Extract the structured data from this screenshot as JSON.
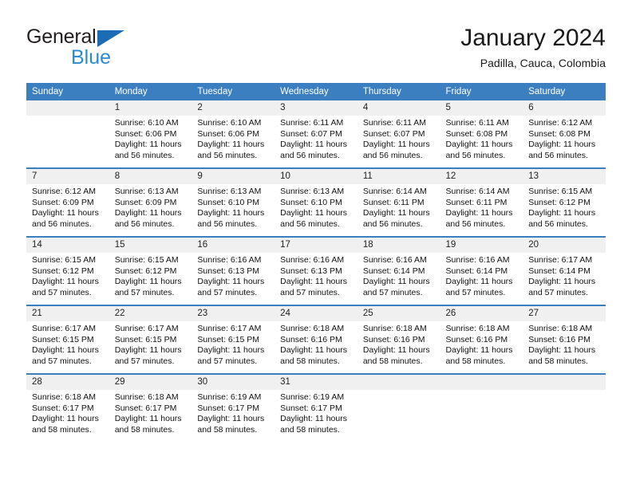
{
  "brand": {
    "name_part1": "General",
    "name_part2": "Blue",
    "triangle_color": "#1b6bb5",
    "text_color_part2": "#2b8ad6"
  },
  "header": {
    "title": "January 2024",
    "location": "Padilla, Cauca, Colombia"
  },
  "theme": {
    "header_bg": "#3c7fc1",
    "header_text": "#ffffff",
    "daynum_bg": "#f0f0f0",
    "cell_bg": "#ffffff",
    "row_divider": "#3c7fc1"
  },
  "weekday_headers": [
    "Sunday",
    "Monday",
    "Tuesday",
    "Wednesday",
    "Thursday",
    "Friday",
    "Saturday"
  ],
  "labels": {
    "sunrise_prefix": "Sunrise:",
    "sunset_prefix": "Sunset:",
    "daylight_prefix": "Daylight:"
  },
  "weeks": [
    {
      "days": [
        {
          "num": "",
          "blank": true,
          "line1": "",
          "line2": "",
          "line3": "",
          "line4": ""
        },
        {
          "num": "1",
          "blank": false,
          "line1": "Sunrise: 6:10 AM",
          "line2": "Sunset: 6:06 PM",
          "line3": "Daylight: 11 hours",
          "line4": "and 56 minutes."
        },
        {
          "num": "2",
          "blank": false,
          "line1": "Sunrise: 6:10 AM",
          "line2": "Sunset: 6:06 PM",
          "line3": "Daylight: 11 hours",
          "line4": "and 56 minutes."
        },
        {
          "num": "3",
          "blank": false,
          "line1": "Sunrise: 6:11 AM",
          "line2": "Sunset: 6:07 PM",
          "line3": "Daylight: 11 hours",
          "line4": "and 56 minutes."
        },
        {
          "num": "4",
          "blank": false,
          "line1": "Sunrise: 6:11 AM",
          "line2": "Sunset: 6:07 PM",
          "line3": "Daylight: 11 hours",
          "line4": "and 56 minutes."
        },
        {
          "num": "5",
          "blank": false,
          "line1": "Sunrise: 6:11 AM",
          "line2": "Sunset: 6:08 PM",
          "line3": "Daylight: 11 hours",
          "line4": "and 56 minutes."
        },
        {
          "num": "6",
          "blank": false,
          "line1": "Sunrise: 6:12 AM",
          "line2": "Sunset: 6:08 PM",
          "line3": "Daylight: 11 hours",
          "line4": "and 56 minutes."
        }
      ]
    },
    {
      "days": [
        {
          "num": "7",
          "blank": false,
          "line1": "Sunrise: 6:12 AM",
          "line2": "Sunset: 6:09 PM",
          "line3": "Daylight: 11 hours",
          "line4": "and 56 minutes."
        },
        {
          "num": "8",
          "blank": false,
          "line1": "Sunrise: 6:13 AM",
          "line2": "Sunset: 6:09 PM",
          "line3": "Daylight: 11 hours",
          "line4": "and 56 minutes."
        },
        {
          "num": "9",
          "blank": false,
          "line1": "Sunrise: 6:13 AM",
          "line2": "Sunset: 6:10 PM",
          "line3": "Daylight: 11 hours",
          "line4": "and 56 minutes."
        },
        {
          "num": "10",
          "blank": false,
          "line1": "Sunrise: 6:13 AM",
          "line2": "Sunset: 6:10 PM",
          "line3": "Daylight: 11 hours",
          "line4": "and 56 minutes."
        },
        {
          "num": "11",
          "blank": false,
          "line1": "Sunrise: 6:14 AM",
          "line2": "Sunset: 6:11 PM",
          "line3": "Daylight: 11 hours",
          "line4": "and 56 minutes."
        },
        {
          "num": "12",
          "blank": false,
          "line1": "Sunrise: 6:14 AM",
          "line2": "Sunset: 6:11 PM",
          "line3": "Daylight: 11 hours",
          "line4": "and 56 minutes."
        },
        {
          "num": "13",
          "blank": false,
          "line1": "Sunrise: 6:15 AM",
          "line2": "Sunset: 6:12 PM",
          "line3": "Daylight: 11 hours",
          "line4": "and 56 minutes."
        }
      ]
    },
    {
      "days": [
        {
          "num": "14",
          "blank": false,
          "line1": "Sunrise: 6:15 AM",
          "line2": "Sunset: 6:12 PM",
          "line3": "Daylight: 11 hours",
          "line4": "and 57 minutes."
        },
        {
          "num": "15",
          "blank": false,
          "line1": "Sunrise: 6:15 AM",
          "line2": "Sunset: 6:12 PM",
          "line3": "Daylight: 11 hours",
          "line4": "and 57 minutes."
        },
        {
          "num": "16",
          "blank": false,
          "line1": "Sunrise: 6:16 AM",
          "line2": "Sunset: 6:13 PM",
          "line3": "Daylight: 11 hours",
          "line4": "and 57 minutes."
        },
        {
          "num": "17",
          "blank": false,
          "line1": "Sunrise: 6:16 AM",
          "line2": "Sunset: 6:13 PM",
          "line3": "Daylight: 11 hours",
          "line4": "and 57 minutes."
        },
        {
          "num": "18",
          "blank": false,
          "line1": "Sunrise: 6:16 AM",
          "line2": "Sunset: 6:14 PM",
          "line3": "Daylight: 11 hours",
          "line4": "and 57 minutes."
        },
        {
          "num": "19",
          "blank": false,
          "line1": "Sunrise: 6:16 AM",
          "line2": "Sunset: 6:14 PM",
          "line3": "Daylight: 11 hours",
          "line4": "and 57 minutes."
        },
        {
          "num": "20",
          "blank": false,
          "line1": "Sunrise: 6:17 AM",
          "line2": "Sunset: 6:14 PM",
          "line3": "Daylight: 11 hours",
          "line4": "and 57 minutes."
        }
      ]
    },
    {
      "days": [
        {
          "num": "21",
          "blank": false,
          "line1": "Sunrise: 6:17 AM",
          "line2": "Sunset: 6:15 PM",
          "line3": "Daylight: 11 hours",
          "line4": "and 57 minutes."
        },
        {
          "num": "22",
          "blank": false,
          "line1": "Sunrise: 6:17 AM",
          "line2": "Sunset: 6:15 PM",
          "line3": "Daylight: 11 hours",
          "line4": "and 57 minutes."
        },
        {
          "num": "23",
          "blank": false,
          "line1": "Sunrise: 6:17 AM",
          "line2": "Sunset: 6:15 PM",
          "line3": "Daylight: 11 hours",
          "line4": "and 57 minutes."
        },
        {
          "num": "24",
          "blank": false,
          "line1": "Sunrise: 6:18 AM",
          "line2": "Sunset: 6:16 PM",
          "line3": "Daylight: 11 hours",
          "line4": "and 58 minutes."
        },
        {
          "num": "25",
          "blank": false,
          "line1": "Sunrise: 6:18 AM",
          "line2": "Sunset: 6:16 PM",
          "line3": "Daylight: 11 hours",
          "line4": "and 58 minutes."
        },
        {
          "num": "26",
          "blank": false,
          "line1": "Sunrise: 6:18 AM",
          "line2": "Sunset: 6:16 PM",
          "line3": "Daylight: 11 hours",
          "line4": "and 58 minutes."
        },
        {
          "num": "27",
          "blank": false,
          "line1": "Sunrise: 6:18 AM",
          "line2": "Sunset: 6:16 PM",
          "line3": "Daylight: 11 hours",
          "line4": "and 58 minutes."
        }
      ]
    },
    {
      "days": [
        {
          "num": "28",
          "blank": false,
          "line1": "Sunrise: 6:18 AM",
          "line2": "Sunset: 6:17 PM",
          "line3": "Daylight: 11 hours",
          "line4": "and 58 minutes."
        },
        {
          "num": "29",
          "blank": false,
          "line1": "Sunrise: 6:18 AM",
          "line2": "Sunset: 6:17 PM",
          "line3": "Daylight: 11 hours",
          "line4": "and 58 minutes."
        },
        {
          "num": "30",
          "blank": false,
          "line1": "Sunrise: 6:19 AM",
          "line2": "Sunset: 6:17 PM",
          "line3": "Daylight: 11 hours",
          "line4": "and 58 minutes."
        },
        {
          "num": "31",
          "blank": false,
          "line1": "Sunrise: 6:19 AM",
          "line2": "Sunset: 6:17 PM",
          "line3": "Daylight: 11 hours",
          "line4": "and 58 minutes."
        },
        {
          "num": "",
          "blank": true,
          "line1": "",
          "line2": "",
          "line3": "",
          "line4": ""
        },
        {
          "num": "",
          "blank": true,
          "line1": "",
          "line2": "",
          "line3": "",
          "line4": ""
        },
        {
          "num": "",
          "blank": true,
          "line1": "",
          "line2": "",
          "line3": "",
          "line4": ""
        }
      ]
    }
  ]
}
